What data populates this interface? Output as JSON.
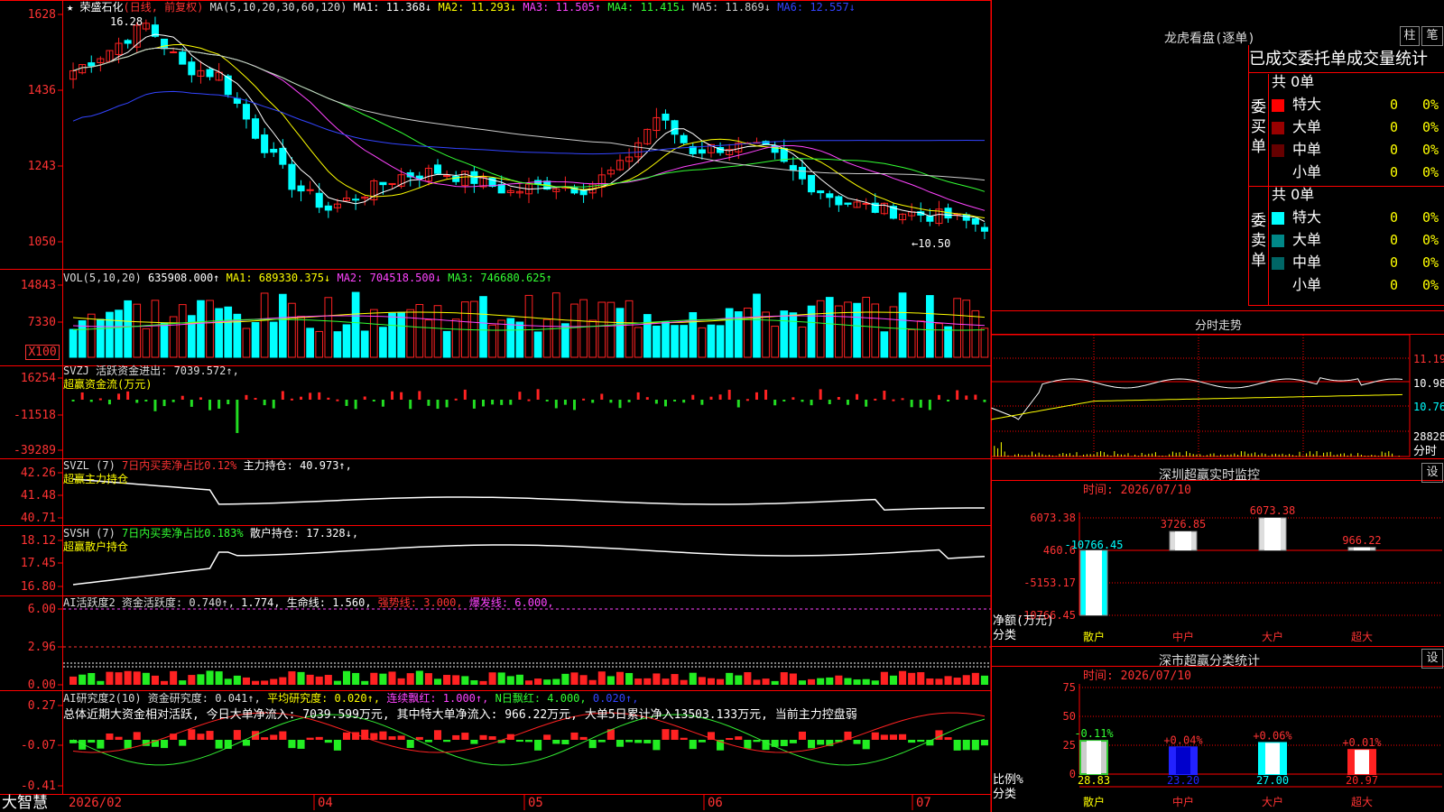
{
  "app": {
    "name": "大智慧",
    "date_label": "2026/02"
  },
  "stock": {
    "name": "荣盛石化",
    "mode": "(日线, 前复权)"
  },
  "kline": {
    "title_ma": "MA(5,10,20,30,60,120)",
    "ma_items": [
      {
        "text": "MA1: 11.368↓",
        "color": "#ffffff"
      },
      {
        "text": "MA2: 11.293↓",
        "color": "#ffff00"
      },
      {
        "text": "MA3: 11.505↑",
        "color": "#ff44ff"
      },
      {
        "text": "MA4: 11.415↓",
        "color": "#33ff33"
      },
      {
        "text": "MA5: 11.869↓",
        "color": "#cccccc"
      },
      {
        "text": "MA6: 12.557↓",
        "color": "#3344ff"
      }
    ],
    "y_ticks": [
      "1628",
      "1436",
      "1243",
      "1050"
    ],
    "high_label": "16.28",
    "low_label": "←10.50",
    "ylim": [
      10.3,
      16.5
    ]
  },
  "vol": {
    "title": "VOL(5,10,20)",
    "value": "635908.000↑",
    "items": [
      {
        "text": "MA1: 689330.375↓",
        "color": "#ffff00"
      },
      {
        "text": "MA2: 704518.500↓",
        "color": "#ff44ff"
      },
      {
        "text": "MA3: 746680.625↑",
        "color": "#33ff33"
      }
    ],
    "y_ticks": [
      "14843",
      "7330"
    ],
    "unit": "X100"
  },
  "svzj": {
    "title": "SVZJ 活跃资金进出: 7039.572↑,",
    "sub": "超赢资金流(万元)",
    "y_ticks": [
      "16254",
      "-11518",
      "-39289"
    ]
  },
  "svzl": {
    "title_a": "SVZL (7)",
    "title_b": "7日内买卖净占比0.12%",
    "title_c": "主力持仓: 40.973↑,",
    "sub": "超赢主力持仓",
    "y_ticks": [
      "42.26",
      "41.48",
      "40.71"
    ]
  },
  "svsh": {
    "title_a": "SVSH (7)",
    "title_b": "7日内买卖净占比0.183%",
    "title_c": "散户持仓: 17.328↓,",
    "sub": "超赢散户持仓",
    "y_ticks": [
      "18.12",
      "17.45",
      "16.80"
    ]
  },
  "ai1": {
    "title_a": "AI活跃度2 资金活跃度: 0.740↑,",
    "title_b": "1.774,",
    "title_c": "生命线: 1.560,",
    "title_d": "强势线: 3.000,",
    "title_e": "爆发线: 6.000,",
    "y_ticks": [
      "6.00",
      "2.96",
      "0.00"
    ]
  },
  "ai2": {
    "title_a": "AI研究度2(10) 资金研究度: 0.041↑,",
    "title_b": "平均研究度: 0.020↑,",
    "title_c": "连续飘红: 1.000↑,",
    "title_d": "N日飘红: 4.000,",
    "title_e": "0.020↑,",
    "summary": "总体近期大资金相对活跃, 今日大单净流入: 7039.599万元, 其中特大单净流入: 966.22万元, 大单5日累计净入13503.133万元, 当前主力控盘弱",
    "y_ticks": [
      "0.27",
      "-0.07",
      "-0.41"
    ]
  },
  "x_labels": [
    "04",
    "05",
    "06",
    "07"
  ],
  "longhu": {
    "title": "龙虎看盘(逐单)",
    "btn1": "柱",
    "btn2": "笔",
    "header": "已成交委托单成交量统计",
    "buy_label": "委买单",
    "sell_label": "委卖单",
    "buy_total": "共 0单",
    "sell_total": "共 0单",
    "rows": [
      {
        "name": "特大",
        "count": "0",
        "pct": "0%"
      },
      {
        "name": "大单",
        "count": "0",
        "pct": "0%"
      },
      {
        "name": "中单",
        "count": "0",
        "pct": "0%"
      },
      {
        "name": "小单",
        "count": "0",
        "pct": "0%"
      }
    ],
    "buy_colors": [
      "#ff0000",
      "#990000",
      "#660000",
      "#000000"
    ],
    "sell_colors": [
      "#00ffff",
      "#008888",
      "#006666",
      "#000000"
    ]
  },
  "fenshi": {
    "title": "分时走势",
    "y_labels": [
      "11.19",
      "10.98",
      "10.76"
    ],
    "vol_label": "28828",
    "sub": "分时"
  },
  "monitor": {
    "title": "深圳超赢实时监控",
    "btn": "设",
    "time": "时间: 2026/07/10",
    "y_ticks": [
      "6073.38",
      "460.6",
      "-5153.17",
      "-10766.45"
    ],
    "ylabel_a": "净额(万元)",
    "ylabel_b": "分类",
    "categories": [
      "散户",
      "中户",
      "大户",
      "超大"
    ],
    "values": [
      -10766.45,
      3726.85,
      6073.38,
      966.22
    ],
    "value_labels": [
      "-10766.45",
      "3726.85",
      "6073.38",
      "966.22"
    ]
  },
  "classify": {
    "title": "深市超赢分类统计",
    "btn": "设",
    "time": "时间: 2026/07/10",
    "y_ticks": [
      "75",
      "50",
      "25",
      "0"
    ],
    "ylabel_a": "比例%",
    "ylabel_b": "分类",
    "categories": [
      "散户",
      "中户",
      "大户",
      "超大"
    ],
    "values": [
      28.83,
      23.2,
      27.0,
      20.97
    ],
    "value_labels": [
      "28.83",
      "23.20",
      "27.00",
      "20.97"
    ],
    "change_labels": [
      "-0.11%",
      "+0.04%",
      "+0.06%",
      "+0.01%"
    ],
    "bar_colors": [
      "#33cc33",
      "#2222ff",
      "#00ffff",
      "#ff2222"
    ]
  },
  "chart_data": {
    "type": "table",
    "monitor_bars": {
      "type": "bar",
      "categories": [
        "散户",
        "中户",
        "大户",
        "超大"
      ],
      "values": [
        -10766.45,
        3726.85,
        6073.38,
        966.22
      ]
    },
    "classify_bars": {
      "type": "bar",
      "categories": [
        "散户",
        "中户",
        "大户",
        "超大"
      ],
      "values": [
        28.83,
        23.2,
        27.0,
        20.97
      ],
      "ylim": [
        0,
        75
      ]
    }
  }
}
